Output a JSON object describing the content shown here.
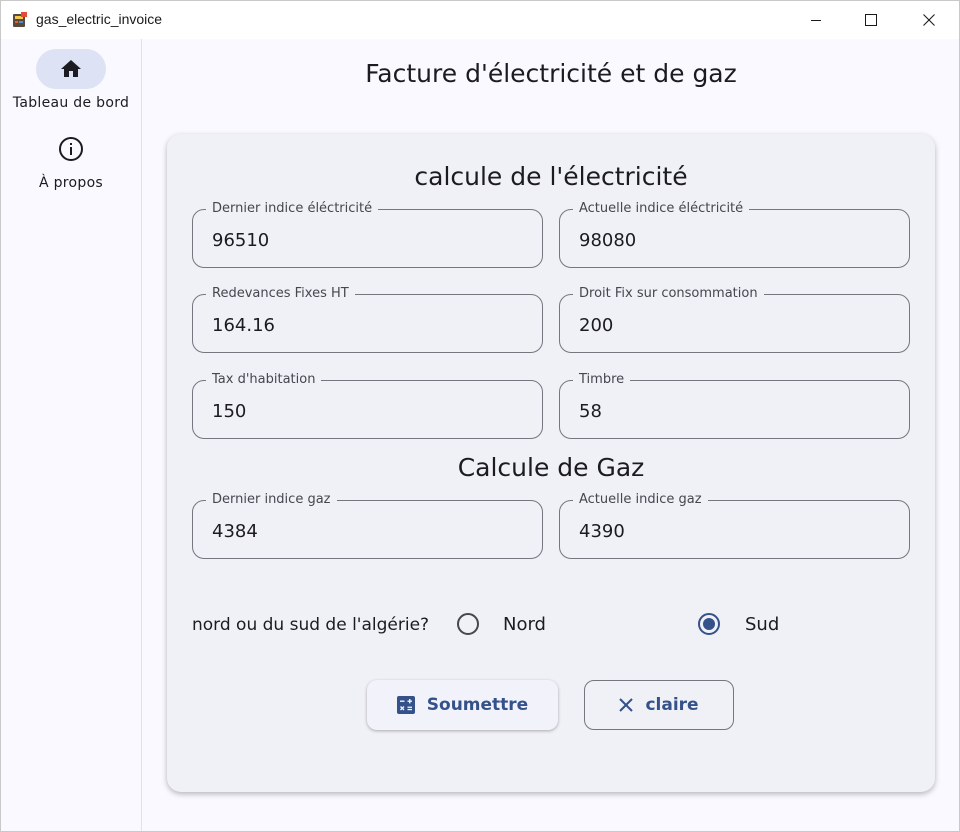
{
  "window": {
    "title": "gas_electric_invoice"
  },
  "rail": {
    "items": [
      {
        "label": "Tableau de bord",
        "icon": "home-icon",
        "active": true
      },
      {
        "label": "À propos",
        "icon": "info-icon",
        "active": false
      }
    ]
  },
  "main": {
    "title": "Facture d'électricité et de gaz",
    "electricity": {
      "heading": "calcule de l'électricité",
      "fields": [
        {
          "label": "Dernier indice éléctricité",
          "value": "96510"
        },
        {
          "label": "Actuelle indice éléctricité",
          "value": "98080"
        },
        {
          "label": "Redevances Fixes HT",
          "value": "164.16"
        },
        {
          "label": "Droit Fix sur consommation",
          "value": "200"
        },
        {
          "label": "Tax d'habitation",
          "value": "150"
        },
        {
          "label": "Timbre",
          "value": "58"
        }
      ]
    },
    "gas": {
      "heading": "Calcule de Gaz",
      "fields": [
        {
          "label": "Dernier indice gaz",
          "value": "4384"
        },
        {
          "label": "Actuelle indice gaz",
          "value": "4390"
        }
      ]
    },
    "region": {
      "question": "nord ou du sud de l'algérie?",
      "options": [
        "Nord",
        "Sud"
      ],
      "selected": "Sud"
    },
    "buttons": {
      "submit": "Soumettre",
      "clear": "claire"
    }
  },
  "colors": {
    "accent": "#34518a",
    "rail_active": "#dde2f4",
    "card": "#f0f0f7",
    "outline": "#74777f"
  }
}
